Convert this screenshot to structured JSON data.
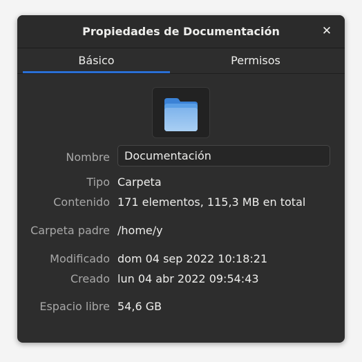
{
  "window": {
    "title": "Propiedades de Documentación",
    "close_glyph": "✕"
  },
  "tabs": [
    {
      "label": "Básico",
      "active": true
    },
    {
      "label": "Permisos",
      "active": false
    }
  ],
  "icon": {
    "name": "folder-icon",
    "color": "#5a9fe6"
  },
  "accent_color": "#2a6fd6",
  "fields": {
    "name": {
      "label": "Nombre",
      "value": "Documentación"
    },
    "type": {
      "label": "Tipo",
      "value": "Carpeta"
    },
    "contents": {
      "label": "Contenido",
      "value": "171 elementos, 115,3 MB en total"
    },
    "parent": {
      "label": "Carpeta padre",
      "value": "/home/y"
    },
    "modified": {
      "label": "Modificado",
      "value": "dom 04 sep 2022 10:18:21"
    },
    "created": {
      "label": "Creado",
      "value": "lun 04 abr 2022 09:54:43"
    },
    "free_space": {
      "label": "Espacio libre",
      "value": "54,6 GB"
    }
  }
}
